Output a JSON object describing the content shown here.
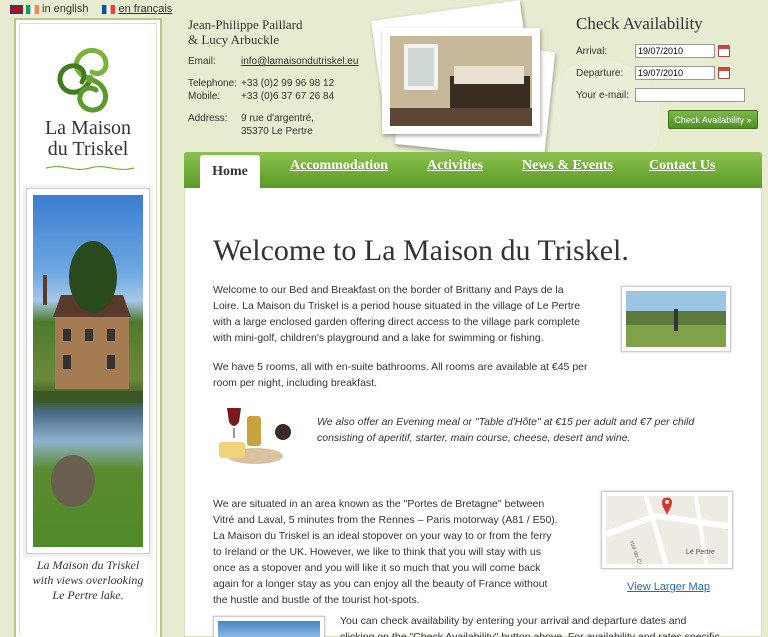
{
  "languages": [
    {
      "label": "in english",
      "flag": "uk-ireland-flag"
    },
    {
      "label": "en français",
      "flag": "france-flag"
    }
  ],
  "logo": {
    "line1": "La Maison",
    "line2": "du Triskel"
  },
  "sidebar": {
    "caption_line1": "La Maison du Triskel",
    "caption_line2": "with views overlooking",
    "caption_line3": "Le Pertre lake."
  },
  "contact": {
    "names_line1": "Jean-Philippe Paillard",
    "names_line2": "& Lucy Arbuckle",
    "email_label": "Email:",
    "email": "info@lamaisondutriskel.eu",
    "telephone_label": "Telephone:",
    "telephone": "+33 (0)2 99 96 98 12",
    "mobile_label": "Mobile:",
    "mobile": "+33 (0)6 37 67 26 84",
    "address_label": "Address:",
    "address_line1": "9 rue d'argentré,",
    "address_line2": "35370 Le Pertre"
  },
  "check": {
    "title": "Check Availability",
    "arrival_label": "Arrival:",
    "arrival_value": "19/07/2010",
    "departure_label": "Departure:",
    "departure_value": "19/07/2010",
    "email_label": "Your e-mail:",
    "email_value": "",
    "button": "Check Availability »"
  },
  "nav": {
    "tabs": [
      "Home",
      "Accommodation",
      "Activities",
      "News & Events",
      "Contact Us"
    ],
    "active": "Home"
  },
  "main": {
    "title": "Welcome to La Maison du Triskel.",
    "p1_l1": "Welcome to our Bed and Breakfast on the border of Brittany and Pays de la",
    "p1_l2": "Loire. La Maison du Triskel is a period house situated in the village of Le Pertre",
    "p1_l3": "with a large enclosed garden offering direct access to the village park complete",
    "p1_l4": "with mini-golf, children's playground and a lake for swimming or fishing.",
    "p2_l1": "We have 5 rooms, all with en-suite bathrooms. All rooms are available at €45 per",
    "p2_l2": "room per night, including breakfast.",
    "p3_l1": "We also offer an Evening meal or \"Table d'Hôte\" at €15 per adult and €7 per child",
    "p3_l2": "consisting of aperitif, starter, main course, cheese, desert and wine.",
    "p4_l1": "We are situated in an area known as the \"Portes de Bretagne\" between",
    "p4_l2": "Vitré and Laval, 5 minutes from the Rennes – Paris motorway (A81 / E50).",
    "p4_l3": "La Maison du Triskel is an ideal stopover on your way to or from the ferry",
    "p4_l4": "to Ireland or the UK. However, we like to think that you will stay with us",
    "p4_l5": "once as a stopover and you will like it so much that you will come back",
    "p4_l6": "again for a longer stay as you can enjoy all the beauty of France without",
    "p4_l7": "the hustle and bustle of the tourist hot-spots.",
    "map_link": "View Larger Map",
    "map_labels": [
      "rue du Calvaire",
      "Le Pertre"
    ],
    "p5_l1": "You can check availability by entering your arrival and departure dates and",
    "p5_l2": "clicking on the \"Check Availability\" button above. For availability and rates specific"
  }
}
